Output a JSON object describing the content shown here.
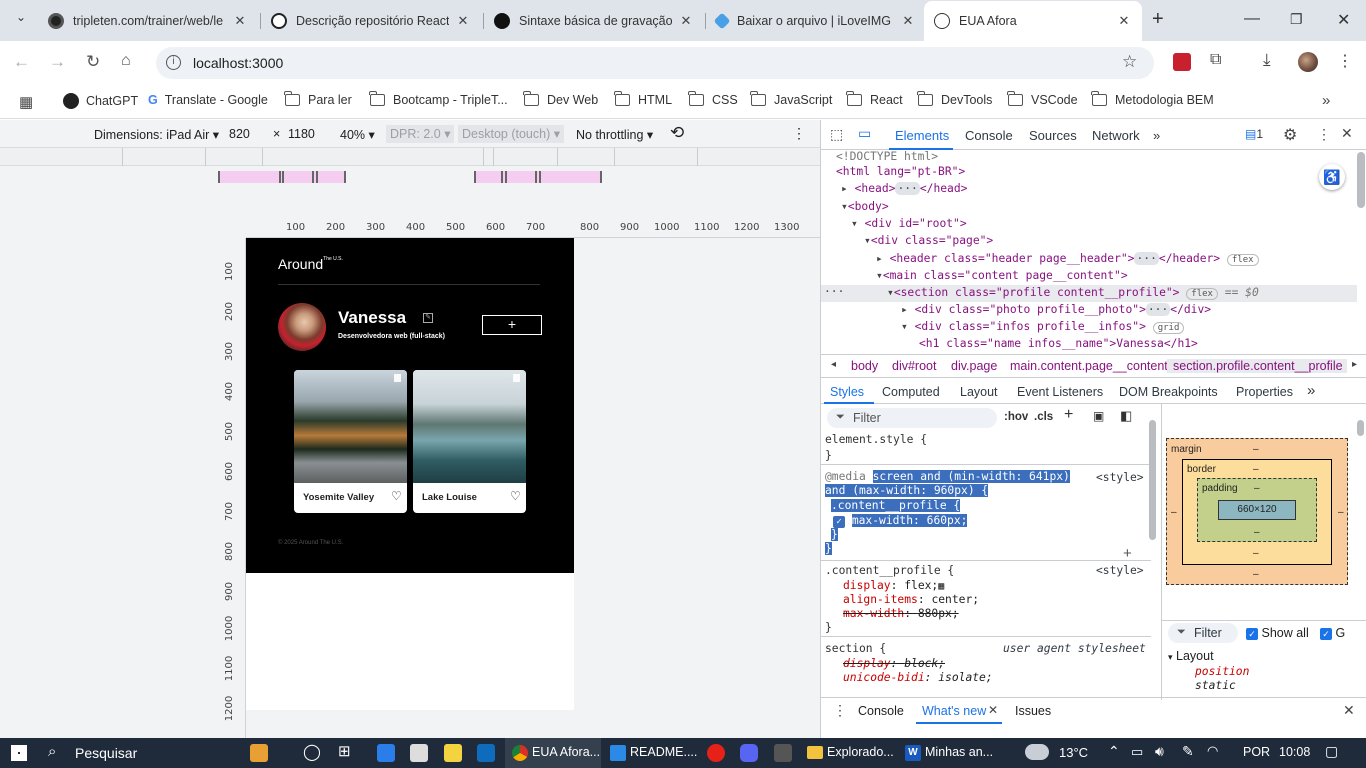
{
  "browser": {
    "tabs": [
      {
        "title": "tripleten.com/trainer/web/le",
        "icon": "tripleten-icon",
        "active": false
      },
      {
        "title": "Descrição repositório React",
        "icon": "openai-icon",
        "active": false
      },
      {
        "title": "Sintaxe básica de gravação e",
        "icon": "github-icon",
        "active": false
      },
      {
        "title": "Baixar o arquivo | iLoveIMG",
        "icon": "ilovimg-icon",
        "active": false
      },
      {
        "title": "EUA Afora",
        "icon": "globe-icon",
        "active": true
      }
    ],
    "url": "localhost:3000",
    "bookmarks": [
      {
        "label": "ChatGPT",
        "type": "site"
      },
      {
        "label": "Translate - Google",
        "type": "site"
      },
      {
        "label": "Para ler",
        "type": "folder"
      },
      {
        "label": "Bootcamp - TripleT...",
        "type": "folder"
      },
      {
        "label": "Dev Web",
        "type": "folder"
      },
      {
        "label": "HTML",
        "type": "folder"
      },
      {
        "label": "CSS",
        "type": "folder"
      },
      {
        "label": "JavaScript",
        "type": "folder"
      },
      {
        "label": "React",
        "type": "folder"
      },
      {
        "label": "DevTools",
        "type": "folder"
      },
      {
        "label": "VSCode",
        "type": "folder"
      },
      {
        "label": "Metodologia BEM",
        "type": "folder"
      }
    ]
  },
  "device_toolbar": {
    "dimensions_label": "Dimensions: iPad Air",
    "width": "820",
    "times": "×",
    "height": "1180",
    "zoom": "40%",
    "dpr": "DPR: 2.0",
    "mode": "Desktop (touch)",
    "throttling": "No throttling"
  },
  "rulers": {
    "top": [
      "100",
      "200",
      "300",
      "400",
      "500",
      "600",
      "700",
      "800",
      "900",
      "1000",
      "1100",
      "1200",
      "1300"
    ],
    "left": [
      "100",
      "200",
      "300",
      "400",
      "500",
      "600",
      "700",
      "800",
      "900",
      "1000",
      "1100",
      "1200"
    ]
  },
  "site": {
    "logo": "Around",
    "logo_sup": "The U.S.",
    "profile_name": "Vanessa",
    "profile_job": "Desenvolvedora web (full-stack)",
    "add_symbol": "+",
    "cards": [
      {
        "title": "Yosemite Valley",
        "like": "♡"
      },
      {
        "title": "Lake Louise",
        "like": "♡"
      }
    ],
    "footer": "© 2025 Around The U.S."
  },
  "devtools": {
    "tabs": [
      "Elements",
      "Console",
      "Sources",
      "Network"
    ],
    "issues_count": "1",
    "dom": [
      "<!DOCTYPE html>",
      "<html lang=\"pt-BR\">",
      "<head>",
      "</head>",
      "<body>",
      "<div id=\"root\">",
      "<div class=\"page\">",
      "<header class=\"header page__header\">",
      "</header>",
      "<main class=\"content page__content\">",
      "<section class=\"profile content__profile\">",
      "== $0",
      "<div class=\"photo profile__photo\">",
      "</div>",
      "<div class=\"infos profile__infos\">",
      "<h1 class=\"name infos__name\">Vanessa</h1>"
    ],
    "badges": {
      "flex": "flex",
      "grid": "grid"
    },
    "breadcrumbs": [
      "body",
      "div#root",
      "div.page",
      "main.content.page__content",
      "section.profile.content__profile"
    ],
    "subtabs": [
      "Styles",
      "Computed",
      "Layout",
      "Event Listeners",
      "DOM Breakpoints",
      "Properties"
    ],
    "filter_placeholder": "Filter",
    "hov": ":hov",
    "cls": ".cls",
    "styles": {
      "element_style": "element.style {",
      "close": "}",
      "media_prefix": "@media",
      "media_query_1": "screen and (min-width: 641px)",
      "media_query_2": "and (max-width: 960px) {",
      "rule1_selector": ".content__profile {",
      "rule1_prop": "max-width",
      "rule1_value": "660px;",
      "source": "<style>",
      "rule2_selector": ".content__profile {",
      "rule2_p1": "display",
      "rule2_v1": "flex;",
      "rule2_p2": "align-items",
      "rule2_v2": "center;",
      "rule2_p3": "max-width",
      "rule2_v3": "880px;",
      "rule3_selector": "section {",
      "rule3_source": "user agent stylesheet",
      "rule3_p1": "display",
      "rule3_v1": "block;",
      "rule3_p2": "unicode-bidi",
      "rule3_v2": "isolate;"
    },
    "boxmodel": {
      "margin": "margin",
      "border": "border",
      "padding": "padding",
      "dash": "–",
      "content": "660×120"
    },
    "computed_filter": "Filter",
    "show_all": "Show all",
    "group": "G",
    "layout_section": "Layout",
    "position_prop": "position",
    "position_val": "static",
    "drawer_tabs": [
      "Console",
      "What's new",
      "Issues"
    ]
  },
  "taskbar": {
    "search": "Pesquisar",
    "apps": [
      "EUA Afora...",
      "README....",
      "Explorado...",
      "Minhas an..."
    ],
    "weather": "13°C",
    "lang": "POR",
    "time": "10:08"
  }
}
